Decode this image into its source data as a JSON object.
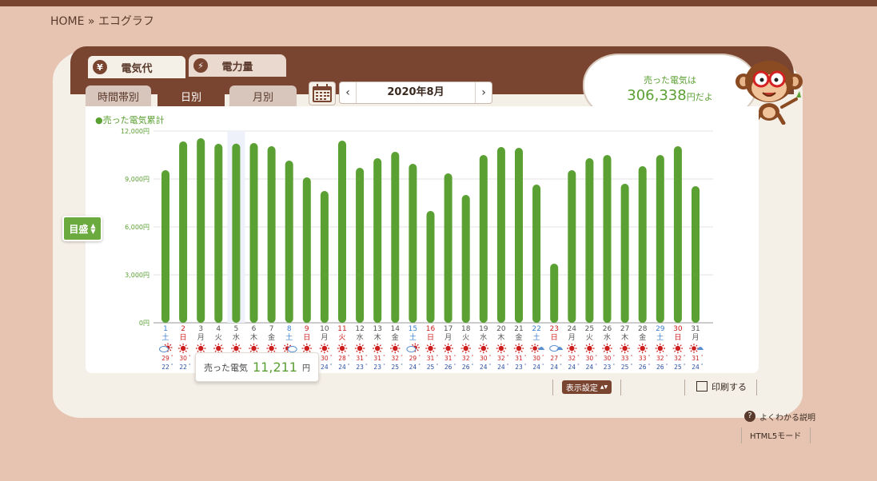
{
  "breadcrumb": "HOME » エコグラフ",
  "main_tabs": [
    {
      "icon": "yen-icon",
      "label": "電気代",
      "active": true
    },
    {
      "icon": "lightning-icon",
      "label": "電力量",
      "active": false
    }
  ],
  "sub_tabs": [
    {
      "label": "時間帯別",
      "active": false
    },
    {
      "label": "日別",
      "active": true
    },
    {
      "label": "月別",
      "active": false
    }
  ],
  "date_nav": {
    "prev": "‹",
    "label": "2020年8月",
    "next": "›"
  },
  "summary": {
    "title": "売った電気は",
    "value": "306,338",
    "suffix": "円だよ"
  },
  "y_axis_button": "目盛",
  "tooltip": {
    "label": "売った電気",
    "value": "11,211",
    "unit": "円"
  },
  "controls": {
    "display_settings": "表示設定",
    "print": "印刷する",
    "help": "よくわかる説明",
    "html5": "HTML5モード"
  },
  "colors": {
    "bar": "#5aa032",
    "brown": "#7a4530",
    "sat": "#3a7fd0",
    "sun": "#cc1e1e",
    "weekday": "#555555"
  },
  "chart_data": {
    "type": "bar",
    "series_label": "●売った電気累計",
    "y_ticks": [
      "0円",
      "3,000円",
      "6,000円",
      "9,000円",
      "12,000円"
    ],
    "ylim": [
      0,
      12000
    ],
    "highlight_day": 5,
    "days": [
      "1",
      "2",
      "3",
      "4",
      "5",
      "6",
      "7",
      "8",
      "9",
      "10",
      "11",
      "12",
      "13",
      "14",
      "15",
      "16",
      "17",
      "18",
      "19",
      "20",
      "21",
      "22",
      "23",
      "24",
      "25",
      "26",
      "27",
      "28",
      "29",
      "30",
      "31"
    ],
    "weekdays": [
      "土",
      "日",
      "月",
      "火",
      "水",
      "木",
      "金",
      "土",
      "日",
      "月",
      "火",
      "水",
      "木",
      "金",
      "土",
      "日",
      "月",
      "火",
      "水",
      "木",
      "金",
      "土",
      "日",
      "月",
      "火",
      "水",
      "木",
      "金",
      "土",
      "日",
      "月"
    ],
    "holidays": [
      11,
      16,
      23
    ],
    "values": [
      9550,
      11350,
      11550,
      11200,
      11211,
      11250,
      11050,
      10150,
      9100,
      8250,
      11400,
      9700,
      10300,
      10700,
      9950,
      7000,
      9350,
      8000,
      10500,
      11000,
      10950,
      8650,
      3700,
      9550,
      10300,
      10500,
      8700,
      9800,
      10500,
      11050,
      8550
    ],
    "weather": [
      "cloud-sun",
      "sun",
      "sun",
      "sun",
      "sun",
      "sun",
      "sun",
      "sun-cloud",
      "sun",
      "sun",
      "sun",
      "sun",
      "sun",
      "sun",
      "cloud-sun",
      "sun",
      "sun",
      "sun",
      "sun",
      "sun",
      "sun",
      "sun-rain",
      "cloud-rain",
      "sun",
      "sun",
      "sun",
      "sun",
      "sun",
      "sun",
      "sun",
      "sun-rain"
    ],
    "temp_high": [
      "29",
      "30",
      "31",
      "32",
      "32",
      "32",
      "31",
      "31",
      "30",
      "30",
      "28",
      "31",
      "31",
      "32",
      "29",
      "31",
      "31",
      "32",
      "30",
      "32",
      "31",
      "30",
      "27",
      "32",
      "30",
      "30",
      "33",
      "33",
      "32",
      "32",
      "31"
    ],
    "temp_low": [
      "22",
      "22",
      "23",
      "23",
      "24",
      "24",
      "24",
      "23",
      "24",
      "24",
      "24",
      "23",
      "23",
      "25",
      "24",
      "25",
      "26",
      "26",
      "24",
      "24",
      "23",
      "24",
      "24",
      "24",
      "24",
      "23",
      "25",
      "26",
      "26",
      "25",
      "24"
    ]
  }
}
